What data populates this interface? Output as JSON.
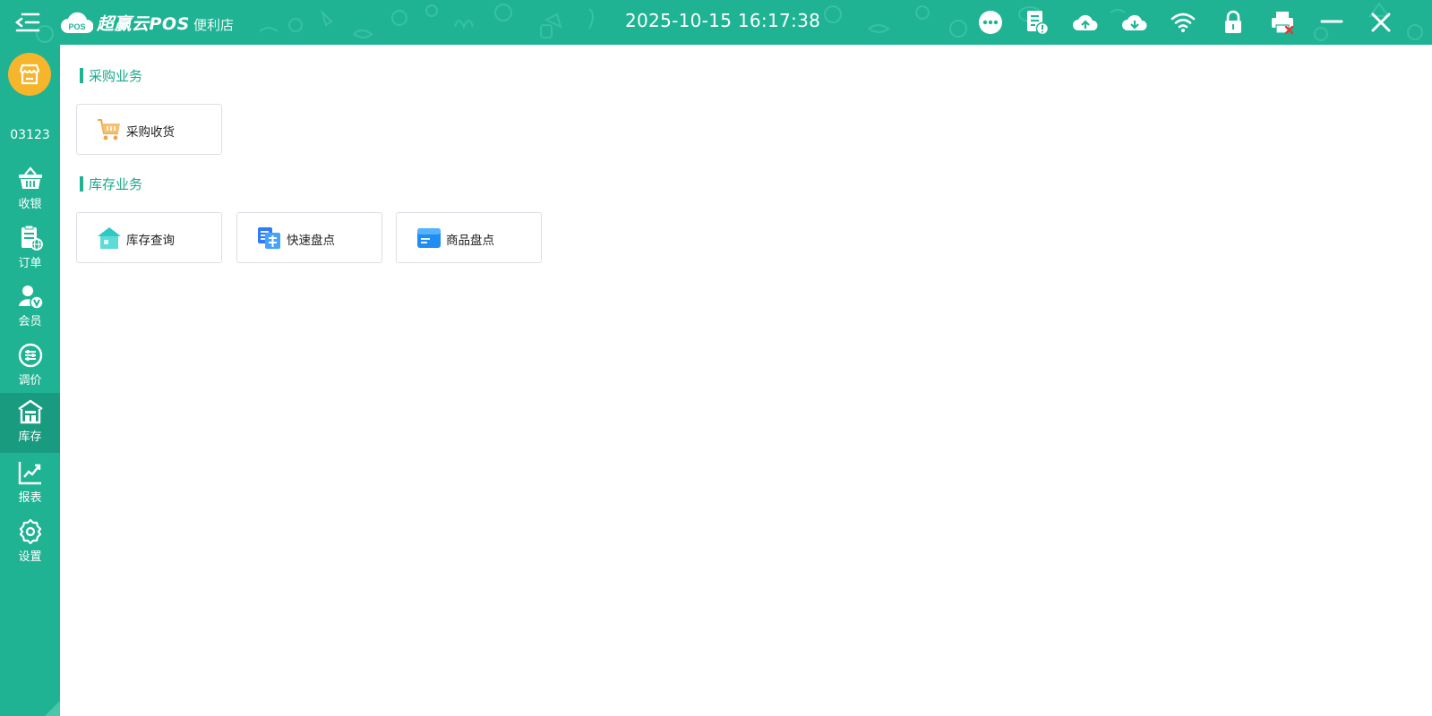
{
  "app": {
    "logo_badge": "POS",
    "name": "超赢云POS",
    "store_type": "便利店",
    "clock": "2025-10-15 16:17:38"
  },
  "header_icons": [
    "menu-icon",
    "more-icon",
    "notice-icon",
    "upload-icon",
    "download-icon",
    "wifi-icon",
    "lock-icon",
    "printer-icon",
    "minimize-icon",
    "close-icon"
  ],
  "colors": {
    "brand": "#1fb394",
    "brand_dark": "#199b80",
    "accent": "#f7b52b",
    "title": "#1aa98b"
  },
  "sidebar": {
    "cashier_id": "03123",
    "items": [
      {
        "label": "收银",
        "icon": "basket-icon"
      },
      {
        "label": "订单",
        "icon": "order-icon"
      },
      {
        "label": "会员",
        "icon": "member-icon"
      },
      {
        "label": "调价",
        "icon": "price-adjust-icon"
      },
      {
        "label": "库存",
        "icon": "warehouse-icon",
        "active": true
      },
      {
        "label": "报表",
        "icon": "chart-icon"
      },
      {
        "label": "设置",
        "icon": "settings-icon"
      }
    ]
  },
  "sections": [
    {
      "title": "采购业务",
      "cards": [
        {
          "label": "采购收货",
          "icon": "shopping-cart-icon"
        }
      ]
    },
    {
      "title": "库存业务",
      "cards": [
        {
          "label": "库存查询",
          "icon": "house-icon"
        },
        {
          "label": "快速盘点",
          "icon": "quick-count-icon"
        },
        {
          "label": "商品盘点",
          "icon": "product-count-icon"
        }
      ]
    }
  ]
}
